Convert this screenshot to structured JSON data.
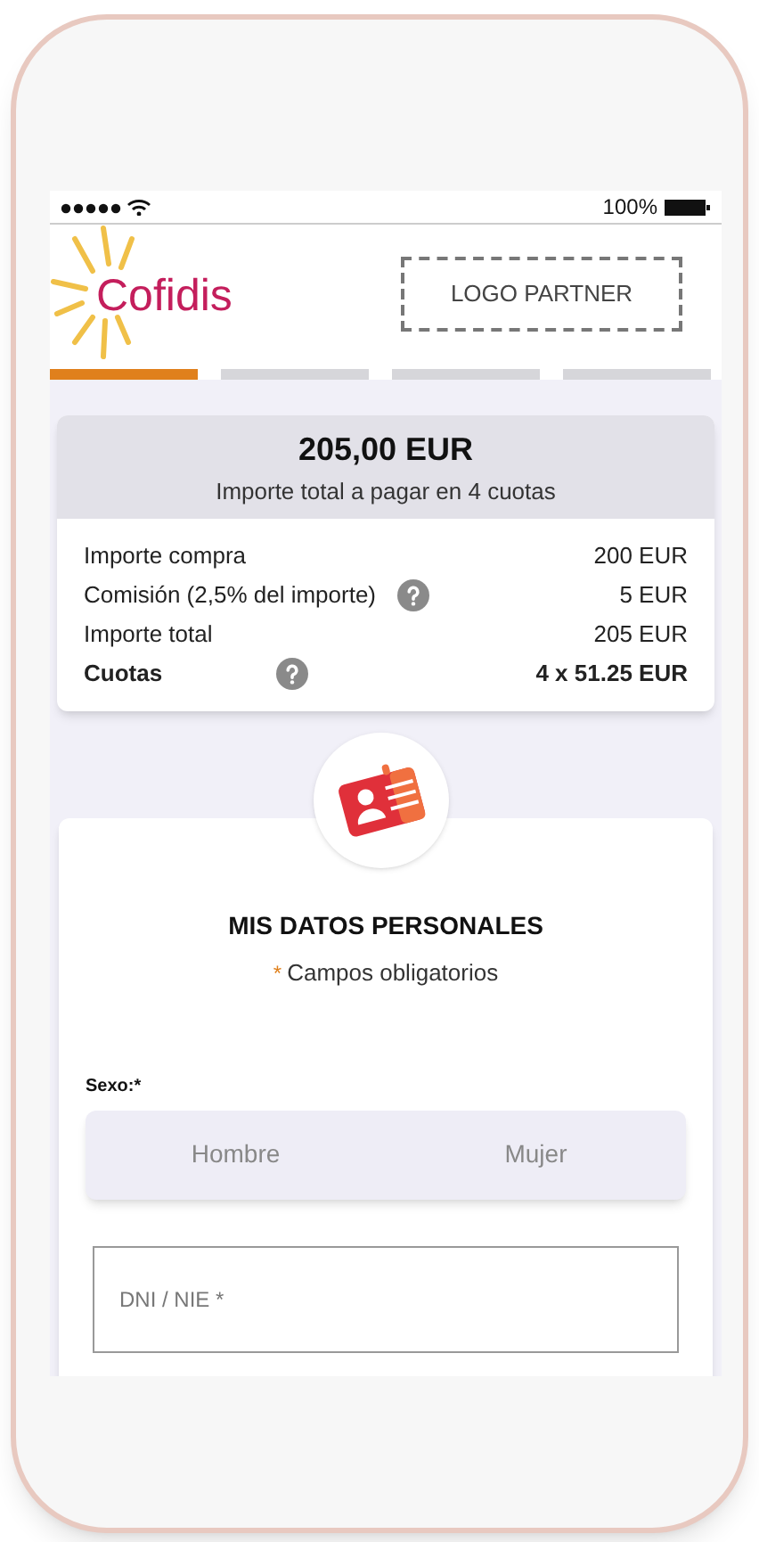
{
  "status_bar": {
    "battery": "100%"
  },
  "header": {
    "brand": "Cofidis",
    "partner_logo": "LOGO PARTNER"
  },
  "steps": [
    {
      "selected": true
    },
    {
      "selected": false
    },
    {
      "selected": false
    },
    {
      "selected": false
    }
  ],
  "summary": {
    "amount": "205,00 EUR",
    "caption": "Importe total a pagar en 4 cuotas",
    "rows": [
      {
        "label": "Importe compra",
        "value": "200 EUR",
        "help": false,
        "bold": false
      },
      {
        "label": "Comisión (2,5% del importe)",
        "value": "5 EUR",
        "help": true,
        "bold": false
      },
      {
        "label": "Importe total",
        "value": "205 EUR",
        "help": false,
        "bold": false
      },
      {
        "label": "Cuotas",
        "value": "4 x 51.25 EUR",
        "help": true,
        "bold": true
      }
    ]
  },
  "form": {
    "title": "MIS DATOS PERSONALES",
    "required_mark": "*",
    "required_note": "Campos obligatorios",
    "sex_label": "Sexo:*",
    "sex_options": [
      {
        "label": "Hombre",
        "selected": false
      },
      {
        "label": "Mujer",
        "selected": false
      }
    ],
    "dni_placeholder": "DNI / NIE *"
  }
}
